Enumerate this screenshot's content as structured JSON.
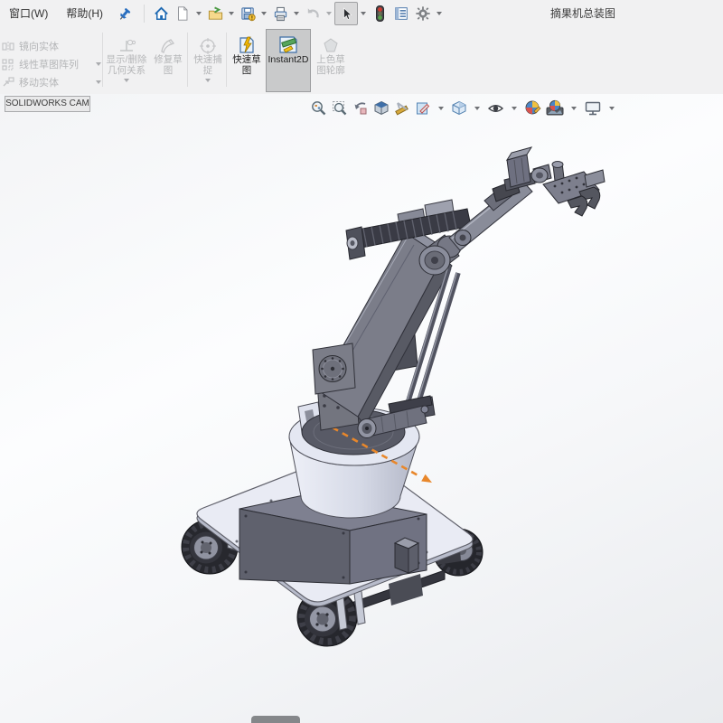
{
  "window": {
    "title": "摘果机总装图"
  },
  "menubar": {
    "window_menu": "窗口(W)",
    "help_menu": "帮助(H)"
  },
  "quick_access": {
    "icons": [
      "pin",
      "home",
      "new-document",
      "open",
      "save",
      "print",
      "undo",
      "select",
      "display-pane",
      "file-properties",
      "options"
    ]
  },
  "command_manager": {
    "tab_label": "SOLIDWORKS CAM",
    "mirror_entities": "镜向实体",
    "linear_sketch_pattern": "线性草图阵列",
    "move_entities": "移动实体",
    "display_delete_relations_line1": "显示/删除",
    "display_delete_relations_line2": "几何关系",
    "repair_sketch_line1": "修复草",
    "repair_sketch_line2": "图",
    "quick_snaps_line1": "快速捕",
    "quick_snaps_line2": "捉",
    "rapid_sketch_line1": "快速草",
    "rapid_sketch_line2": "图",
    "instant2d_label": "Instant2D",
    "shaded_contours_line1": "上色草",
    "shaded_contours_line2": "图轮廓"
  },
  "heads_up": {
    "icons": [
      "zoom-to-fit",
      "zoom-to-area",
      "previous-view",
      "section-view",
      "measure",
      "dynamic-annotation-views",
      "view-orientation",
      "hide-show-items",
      "edit-appearance",
      "apply-scene",
      "view-settings"
    ]
  },
  "viewport": {
    "content": "isometric CAD model of fruit-picking robot arm on four-wheel cart",
    "colors": {
      "explode_line": "#e8872b",
      "model_gray": "#7b7d89",
      "platform_light": "#e9ebf4",
      "toolbar_bg": "#f1f1f2",
      "pressed_button": "#c9cacb"
    }
  }
}
